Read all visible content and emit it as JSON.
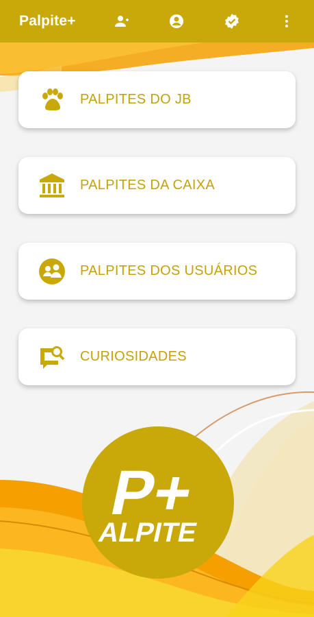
{
  "appbar": {
    "title": "Palpite+",
    "icons": [
      "person-add-icon",
      "account-circle-icon",
      "verified-badge-icon",
      "more-vert-icon"
    ]
  },
  "menu": {
    "items": [
      {
        "label": "PALPITES DO JB",
        "icon": "paw-icon"
      },
      {
        "label": "PALPITES DA CAIXA",
        "icon": "bank-icon"
      },
      {
        "label": "PALPITES DOS USUÁRIOS",
        "icon": "users-circle-icon"
      },
      {
        "label": "CURIOSIDADES",
        "icon": "comment-search-icon"
      }
    ]
  },
  "logo": {
    "big_text": "P+",
    "small_text": "ALPITE"
  },
  "colors": {
    "primary": "#c9a80a",
    "label": "#c5a20a",
    "accent_orange": "#f5a000",
    "background": "#f4f4f4"
  }
}
